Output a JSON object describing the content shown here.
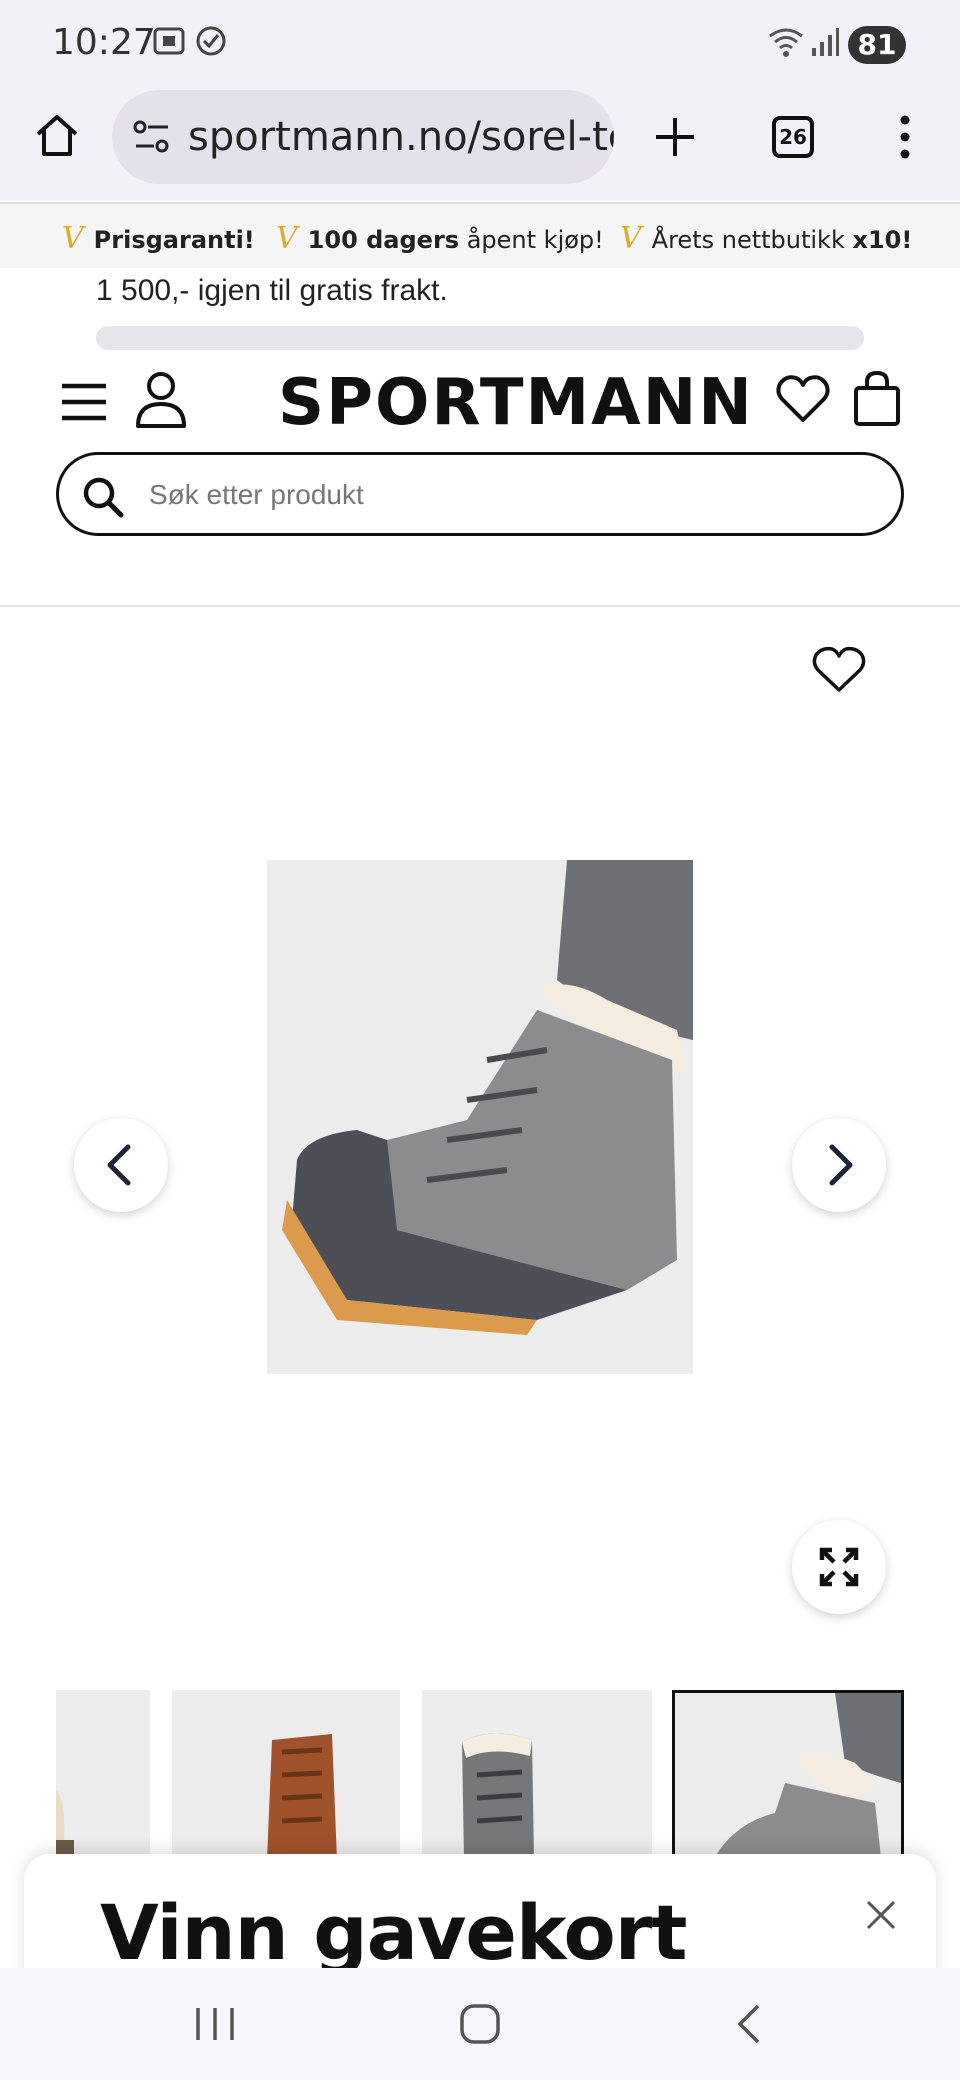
{
  "status_bar": {
    "time": "10:27",
    "battery": "81"
  },
  "browser": {
    "url": "sportmann.no/sorel-tc",
    "tabs_count": "26"
  },
  "promo": {
    "v_mark": "V",
    "items": [
      {
        "bold": "Prisgaranti!",
        "rest": ""
      },
      {
        "bold": "100 dagers",
        "rest": " åpent kjøp!"
      },
      {
        "lead": "Årets nettbutikk ",
        "bold": "x10!"
      }
    ]
  },
  "shipping": {
    "text": "1 500,- igjen til gratis frakt.",
    "progress": 0.0
  },
  "header": {
    "logo": "SPORTMANN",
    "search_placeholder": "Søk etter produkt"
  },
  "popup": {
    "title": "Vinn gavekort"
  },
  "colors": {
    "accent": "#d8ad2a",
    "text": "#111111",
    "divider": "#e3e3e3",
    "boot_gray": "#8c8c8e",
    "boot_sole": "#dc9a4c",
    "boot_brown": "#a0522d"
  },
  "icons": [
    "home-icon",
    "site-settings-icon",
    "plus-icon",
    "tabs-icon",
    "more-vert-icon",
    "hamburger-icon",
    "account-icon",
    "heart-icon",
    "bag-icon",
    "search-icon",
    "chevron-left-icon",
    "chevron-right-icon",
    "expand-icon",
    "close-icon"
  ]
}
